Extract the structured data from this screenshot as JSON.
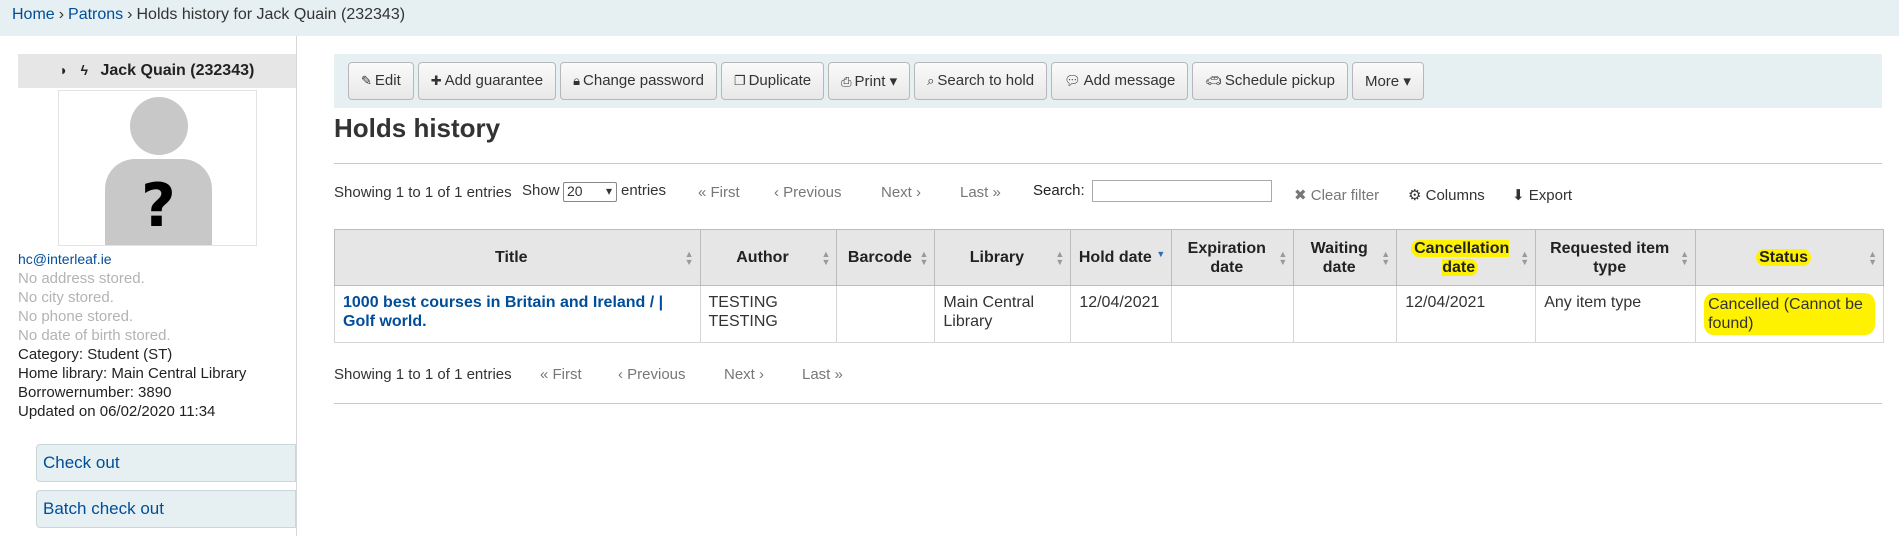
{
  "breadcrumb": {
    "home": "Home",
    "patrons": "Patrons",
    "current": "Holds history for Jack Quain (232343)",
    "sep": "›"
  },
  "patron": {
    "name": "Jack Quain (232343)",
    "email": "hc@interleaf.ie",
    "no_address": "No address stored.",
    "no_city": "No city stored.",
    "no_phone": "No phone stored.",
    "no_dob": "No date of birth stored.",
    "category": "Category: Student (ST)",
    "home_library": "Home library: Main Central Library",
    "borrowernumber": "Borrowernumber: 3890",
    "updated": "Updated on 06/02/2020 11:34",
    "avatar_mark": "?"
  },
  "sidebar": {
    "check_out": "Check out",
    "batch_check_out": "Batch check out"
  },
  "toolbar": {
    "edit": "Edit",
    "add_guarantee": "Add guarantee",
    "change_password": "Change password",
    "duplicate": "Duplicate",
    "print": "Print",
    "search_to_hold": "Search to hold",
    "add_message": "Add message",
    "schedule_pickup": "Schedule pickup",
    "more": "More"
  },
  "page": {
    "title": "Holds history"
  },
  "table_controls": {
    "showing": "Showing 1 to 1 of 1 entries",
    "show": "Show",
    "entries_value": "20",
    "entries": "entries",
    "first": "« First",
    "previous": "‹ Previous",
    "next": "Next ›",
    "last": "Last »",
    "search_label": "Search:",
    "search_value": "",
    "clear_filter": "Clear filter",
    "columns": "Columns",
    "export": "Export"
  },
  "table": {
    "headers": [
      "Title",
      "Author",
      "Barcode",
      "Library",
      "Hold date",
      "Expiration date",
      "Waiting date",
      "Cancellation date",
      "Requested item type",
      "Status"
    ],
    "rows": [
      {
        "title": "1000 best courses in Britain and Ireland / | Golf world.",
        "author": "TESTING TESTING",
        "barcode": "",
        "library": "Main Central Library",
        "hold_date": "12/04/2021",
        "expiration_date": "",
        "waiting_date": "",
        "cancellation_date": "12/04/2021",
        "item_type": "Any item type",
        "status": "Cancelled (Cannot be found)"
      }
    ]
  },
  "colors": {
    "highlight": "#fff200",
    "link": "#004d99",
    "toolbar_bg": "#e6f0f2"
  }
}
